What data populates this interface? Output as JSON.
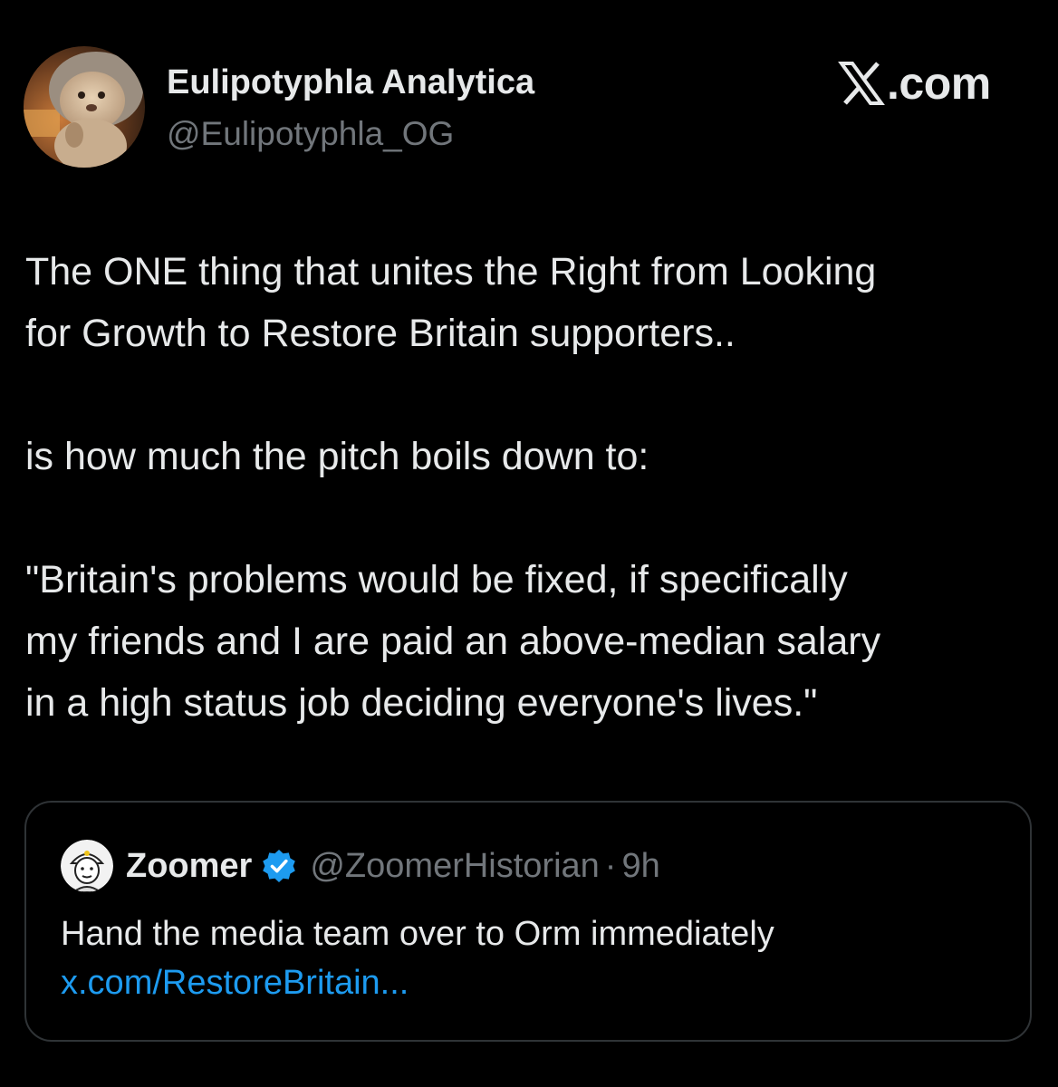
{
  "post": {
    "author": {
      "name": "Eulipotyphla Analytica",
      "handle": "@Eulipotyphla_OG",
      "avatar_icon": "hedgehog-avatar-icon"
    },
    "site_badge": {
      "text": ".com",
      "icon": "x-logo-icon"
    },
    "body": {
      "line1": "The ONE thing that unites the Right from Looking",
      "line2": "for Growth to Restore Britain supporters..",
      "line3": "is how much the pitch boils down to:",
      "line4": "\"Britain's problems would be fixed, if specifically",
      "line5": "my friends and I are paid an above-median salary",
      "line6": "in a high status job deciding everyone's lives.\""
    }
  },
  "quoted_post": {
    "author": {
      "name": "Zoomer",
      "handle": "@ZoomerHistorian",
      "avatar_icon": "cartoon-avatar-icon",
      "verified_icon": "verified-badge-icon"
    },
    "separator": "·",
    "time": "9h",
    "text": "Hand the media team over to Orm immediately",
    "link": "x.com/RestoreBritain..."
  },
  "colors": {
    "background": "#000000",
    "text_primary": "#e7e9ea",
    "text_secondary": "#71767b",
    "link": "#1d9bf0",
    "border": "#2f3336"
  }
}
